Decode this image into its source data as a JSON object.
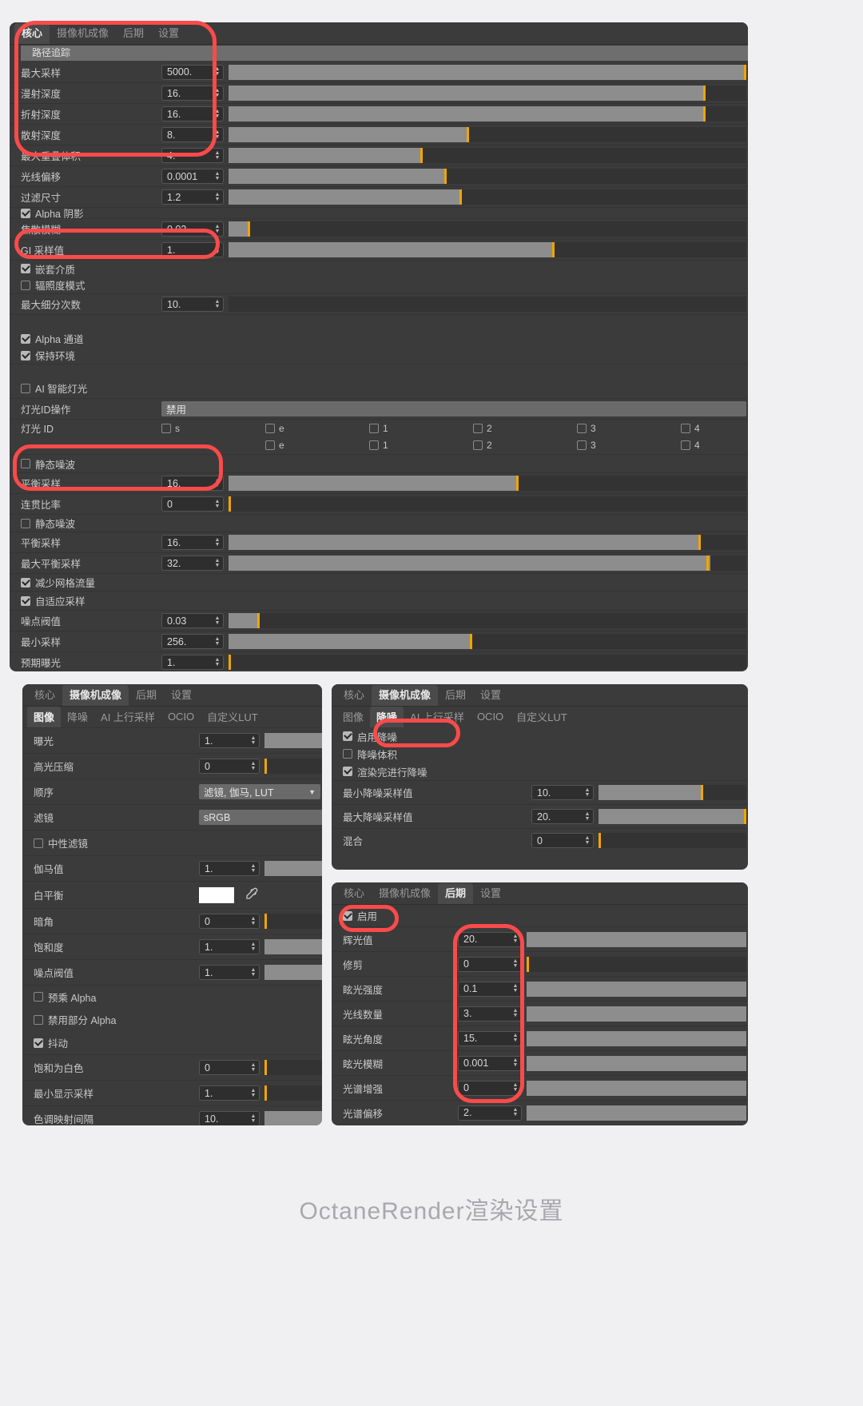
{
  "caption": "OctaneRender渲染设置",
  "colors": {
    "knob": "#f0a500",
    "annotation": "#fb4a4a",
    "panel_bg": "#3b3b3b",
    "group_bg": "#6e6e6e"
  },
  "main_panel": {
    "tabs": [
      {
        "label": "核心",
        "active": true
      },
      {
        "label": "摄像机成像",
        "active": false
      },
      {
        "label": "后期",
        "active": false
      },
      {
        "label": "设置",
        "active": false
      }
    ],
    "group_title": "路径追踪",
    "rows": [
      {
        "label": "最大采样",
        "value": "5000.",
        "fill": 100,
        "knob": 100
      },
      {
        "label": "漫射深度",
        "value": "16.",
        "fill": 92,
        "knob": 92
      },
      {
        "label": "折射深度",
        "value": "16.",
        "fill": 92,
        "knob": 92
      },
      {
        "label": "散射深度",
        "value": "8.",
        "fill": 46,
        "knob": 46
      },
      {
        "label": "最大重叠体积",
        "value": "4.",
        "fill": 36,
        "knob": 36
      },
      {
        "label": "光线偏移",
        "value": "0.0001",
        "fill": 41,
        "knob": 41
      },
      {
        "label": "过滤尺寸",
        "value": "1.2",
        "fill": 44,
        "knob": 44
      }
    ],
    "alpha_shadow": {
      "label": "Alpha 阴影",
      "checked": true
    },
    "caustic_blur": {
      "label": "焦散模糊",
      "value": "0.02",
      "fill": 4,
      "knob": 4
    },
    "gi_rows": [
      {
        "label": "GI 采样值",
        "value": "1.",
        "fill": 62,
        "knob": 62
      }
    ],
    "gi_checks": [
      {
        "label": "嵌套介质",
        "checked": true
      },
      {
        "label": "辐照度模式",
        "checked": false
      }
    ],
    "subdiv": {
      "label": "最大细分次数",
      "value": "10.",
      "fill": 0,
      "knob": 0
    },
    "alpha_checks": [
      {
        "label": "Alpha 通道",
        "checked": true
      },
      {
        "label": "保持环境",
        "checked": true
      }
    ],
    "ai_light": {
      "label": "AI 智能灯光",
      "checked": false
    },
    "light_id_action": {
      "label": "灯光ID操作",
      "value": "禁用"
    },
    "light_id": {
      "label": "灯光 ID",
      "row1": [
        "s",
        "e",
        "1",
        "2",
        "3",
        "4"
      ],
      "row2": [
        "e",
        "1",
        "2",
        "3",
        "4"
      ]
    },
    "static_noise_1": {
      "label": "静态噪波",
      "checked": false
    },
    "balance_1": {
      "label": "平衡采样",
      "value": "16.",
      "fill": 55,
      "knob": 55
    },
    "coherent": {
      "label": "连贯比率",
      "value": "0",
      "fill": 0,
      "knob": 0
    },
    "static_noise_2": {
      "label": "静态噪波",
      "checked": false
    },
    "balance_2": {
      "label": "平衡采样",
      "value": "16.",
      "fill": 89,
      "knob": 89
    },
    "balance_max": {
      "label": "最大平衡采样",
      "value": "32.",
      "fill": 91,
      "knob": 91
    },
    "reduce_mesh": {
      "label": "减少网格流量",
      "checked": true
    },
    "adaptive": {
      "label": "自适应采样",
      "checked": true
    },
    "noise_thresh": {
      "label": "噪点阀值",
      "value": "0.03",
      "fill": 7,
      "knob": 7
    },
    "min_samples": {
      "label": "最小采样",
      "value": "256.",
      "fill": 46,
      "knob": 46
    },
    "expected_exposure": {
      "label": "预期曝光",
      "value": "1.",
      "fill": 0,
      "knob": 0
    }
  },
  "image_panel": {
    "tabs": [
      {
        "label": "核心",
        "active": false
      },
      {
        "label": "摄像机成像",
        "active": true
      },
      {
        "label": "后期",
        "active": false
      },
      {
        "label": "设置",
        "active": false
      }
    ],
    "subtabs": [
      {
        "label": "图像",
        "active": true
      },
      {
        "label": "降噪",
        "active": false
      },
      {
        "label": "AI 上行采样",
        "active": false
      },
      {
        "label": "OCIO",
        "active": false
      },
      {
        "label": "自定义LUT",
        "active": false
      }
    ],
    "exposure": {
      "label": "曝光",
      "value": "1.",
      "fill": 100,
      "knob": -1
    },
    "highlight": {
      "label": "高光压缩",
      "value": "0",
      "fill": 0,
      "knob": 0
    },
    "order": {
      "label": "顺序",
      "value": "滤镜, 伽马, LUT"
    },
    "filter": {
      "label": "滤镜",
      "value": "sRGB"
    },
    "neutral": {
      "label": "中性滤镜",
      "checked": false
    },
    "gamma": {
      "label": "伽马值",
      "value": "1.",
      "fill": 100,
      "knob": -1
    },
    "white_balance": {
      "label": "白平衡",
      "swatch": "#ffffff"
    },
    "vignette": {
      "label": "暗角",
      "value": "0",
      "fill": 0,
      "knob": 0
    },
    "saturation": {
      "label": "饱和度",
      "value": "1.",
      "fill": 100,
      "knob": -1
    },
    "noise_thresh": {
      "label": "噪点阀值",
      "value": "1.",
      "fill": 100,
      "knob": -1
    },
    "premultiply": {
      "label": "预乘 Alpha",
      "checked": false
    },
    "disable_partial": {
      "label": "禁用部分 Alpha",
      "checked": false
    },
    "dither": {
      "label": "抖动",
      "checked": true
    },
    "sat_to_white": {
      "label": "饱和为白色",
      "value": "0",
      "fill": 0,
      "knob": 0
    },
    "min_display": {
      "label": "最小显示采样",
      "value": "1.",
      "fill": 0,
      "knob": 0
    },
    "tonemap_interval": {
      "label": "色调映射间隔",
      "value": "10.",
      "fill": 100,
      "knob": -1
    }
  },
  "denoise_panel": {
    "tabs": [
      {
        "label": "核心",
        "active": false
      },
      {
        "label": "摄像机成像",
        "active": true
      },
      {
        "label": "后期",
        "active": false
      },
      {
        "label": "设置",
        "active": false
      }
    ],
    "subtabs": [
      {
        "label": "图像",
        "active": false
      },
      {
        "label": "降噪",
        "active": true
      },
      {
        "label": "AI 上行采样",
        "active": false
      },
      {
        "label": "OCIO",
        "active": false
      },
      {
        "label": "自定义LUT",
        "active": false
      }
    ],
    "enable_denoise": {
      "label": "启用降噪",
      "checked": true
    },
    "denoise_volume": {
      "label": "降噪体积",
      "checked": false
    },
    "denoise_on_done": {
      "label": "渲染完进行降噪",
      "checked": true
    },
    "min_denoise": {
      "label": "最小降噪采样值",
      "value": "10.",
      "fill": 75,
      "knob": 75
    },
    "max_denoise": {
      "label": "最大降噪采样值",
      "value": "20.",
      "fill": 100,
      "knob": 100
    },
    "blend": {
      "label": "混合",
      "value": "0",
      "fill": 0,
      "knob": 0
    }
  },
  "post_panel": {
    "tabs": [
      {
        "label": "核心",
        "active": false
      },
      {
        "label": "摄像机成像",
        "active": false
      },
      {
        "label": "后期",
        "active": true
      },
      {
        "label": "设置",
        "active": false
      }
    ],
    "enable": {
      "label": "启用",
      "checked": true
    },
    "rows": [
      {
        "label": "辉光值",
        "value": "20.",
        "fill": 100,
        "knob": -1
      },
      {
        "label": "修剪",
        "value": "0",
        "fill": 0,
        "knob": 0
      },
      {
        "label": "眩光强度",
        "value": "0.1",
        "fill": 100,
        "knob": -1
      },
      {
        "label": "光线数量",
        "value": "3.",
        "fill": 100,
        "knob": -1
      },
      {
        "label": "眩光角度",
        "value": "15.",
        "fill": 100,
        "knob": -1
      },
      {
        "label": "眩光模糊",
        "value": "0.001",
        "fill": 100,
        "knob": -1
      },
      {
        "label": "光谱增强",
        "value": "0",
        "fill": 100,
        "knob": -1
      },
      {
        "label": "光谱偏移",
        "value": "2.",
        "fill": 100,
        "knob": -1
      }
    ]
  }
}
